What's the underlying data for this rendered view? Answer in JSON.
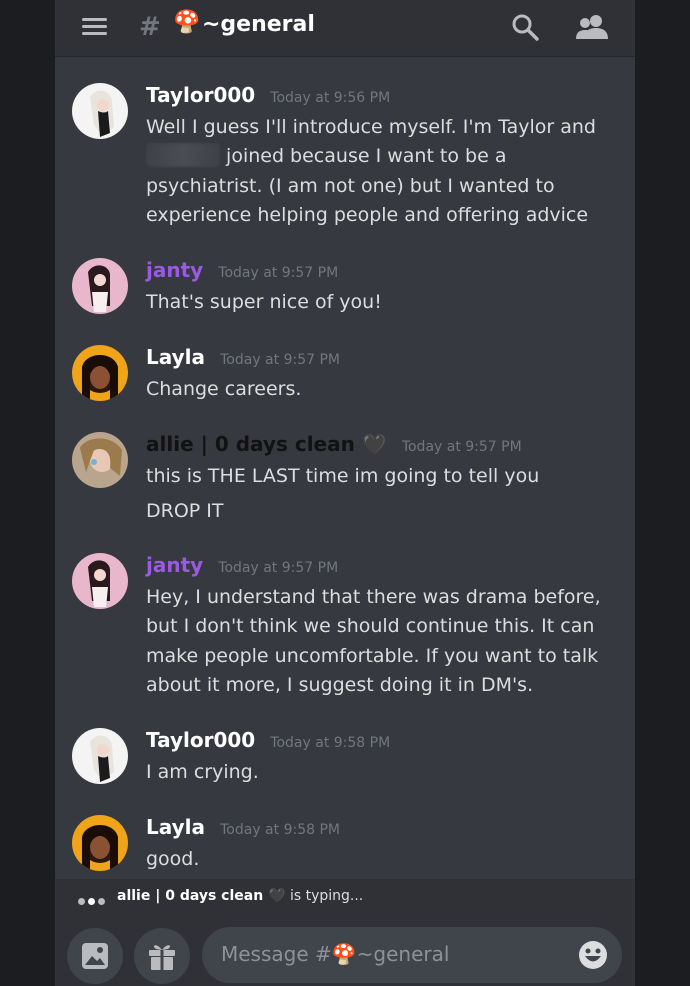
{
  "header": {
    "hash": "#",
    "channel_emoji": "🍄",
    "channel_name": "~general"
  },
  "messages": [
    {
      "username": "Taylor000",
      "username_color": "#ffffff",
      "timestamp": "Today at 9:56 PM",
      "text_a": "Well I guess I'll introduce myself. I'm Taylor and",
      "text_b": "joined because I want to be a psychiatrist. (I am not one) but I wanted to experience helping people and offering advice"
    },
    {
      "username": "janty",
      "username_color": "#9b59e6",
      "timestamp": "Today at 9:57 PM",
      "text": "That's super nice of you!"
    },
    {
      "username": "Layla",
      "username_color": "#ffffff",
      "timestamp": "Today at 9:57 PM",
      "text": "Change careers."
    },
    {
      "username": "allie | 0 days clean 🖤",
      "username_color": "#121212",
      "timestamp": "Today at 9:57 PM",
      "text": "this is THE LAST time im going to tell you",
      "text2": "DROP IT"
    },
    {
      "username": "janty",
      "username_color": "#9b59e6",
      "timestamp": "Today at 9:57 PM",
      "text": "Hey, I understand that there was drama before, but I don't think we should continue this. It can make people uncomfortable. If you want to talk about it more, I suggest doing it in DM's."
    },
    {
      "username": "Taylor000",
      "username_color": "#ffffff",
      "timestamp": "Today at 9:58 PM",
      "text": "I am crying."
    },
    {
      "username": "Layla",
      "username_color": "#ffffff",
      "timestamp": "Today at 9:58 PM",
      "text": "good."
    }
  ],
  "typing": {
    "user": "allie | 0 days clean 🖤",
    "suffix": "is typing..."
  },
  "composer": {
    "placeholder": "Message #🍄~general"
  }
}
